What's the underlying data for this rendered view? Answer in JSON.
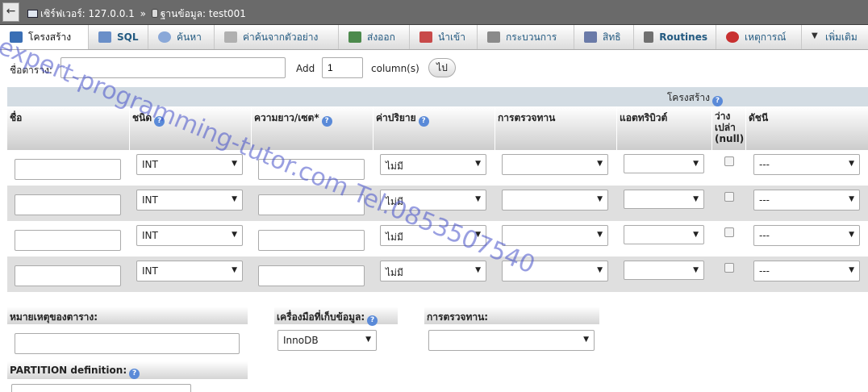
{
  "breadcrumb": {
    "back": "←",
    "server_label": "เซิร์ฟเวอร์: 127.0.0.1",
    "separator": "»",
    "database_label": "ฐานข้อมูล: test001"
  },
  "tabs": [
    {
      "label": "โครงสร้าง",
      "icon": "structure-icon",
      "color": "#3a6fb5"
    },
    {
      "label": "SQL",
      "icon": "sql-icon",
      "color": "#6a8fc8"
    },
    {
      "label": "ค้นหา",
      "icon": "search-icon",
      "color": "#8aa8d8"
    },
    {
      "label": "ค่าค้นจากตัวอย่าง",
      "icon": "query-icon",
      "color": "#b0b0b0"
    },
    {
      "label": "ส่งออก",
      "icon": "export-icon",
      "color": "#4c8a4c"
    },
    {
      "label": "นำเข้า",
      "icon": "import-icon",
      "color": "#c84a4a"
    },
    {
      "label": "กระบวนการ",
      "icon": "wrench-icon",
      "color": "#8a8a8a"
    },
    {
      "label": "สิทธิ",
      "icon": "privileges-icon",
      "color": "#6a7aa8"
    },
    {
      "label": "Routines",
      "icon": "routines-icon",
      "color": "#707070"
    },
    {
      "label": "เหตุการณ์",
      "icon": "clock-icon",
      "color": "#c83030"
    },
    {
      "label": "เพิ่มเติม",
      "icon": "chevron-down-icon",
      "color": "#333333"
    }
  ],
  "name_row": {
    "table_name_label": "ชื่อตาราง:",
    "table_name_value": "",
    "add_label": "Add",
    "add_count": "1",
    "columns_label": "column(s)",
    "go_label": "ไป"
  },
  "structure": {
    "title": "โครงสร้าง",
    "headers": {
      "name": "ชื่อ",
      "type": "ชนิด",
      "length": "ความยาว/เซต*",
      "default": "ค่าปริยาย",
      "collation": "การตรวจทาน",
      "attributes": "แอตทริบิวต์",
      "null": "ว่าง เปล่า (null)",
      "index": "ดัชนี"
    },
    "rows": [
      {
        "type": "INT",
        "default": "ไม่มี",
        "index": "---"
      },
      {
        "type": "INT",
        "default": "ไม่มี",
        "index": "---"
      },
      {
        "type": "INT",
        "default": "ไม่มี",
        "index": "---"
      },
      {
        "type": "INT",
        "default": "ไม่มี",
        "index": "---"
      }
    ]
  },
  "bottom": {
    "comments_label": "หมายเหตุของตาราง:",
    "engine_label": "เครื่องมือที่เก็บข้อมูล:",
    "engine_value": "InnoDB",
    "collation_label": "การตรวจทาน:",
    "partition_label": "PARTITION definition:"
  },
  "watermark": "expert-programming-tutor.com Tel.0853507540",
  "colors": {
    "link": "#235a81",
    "topbar": "#6a6a6a",
    "header_bar": "#d3dce3",
    "row_alt": "#dfdfdf",
    "watermark": "#4650c8"
  }
}
